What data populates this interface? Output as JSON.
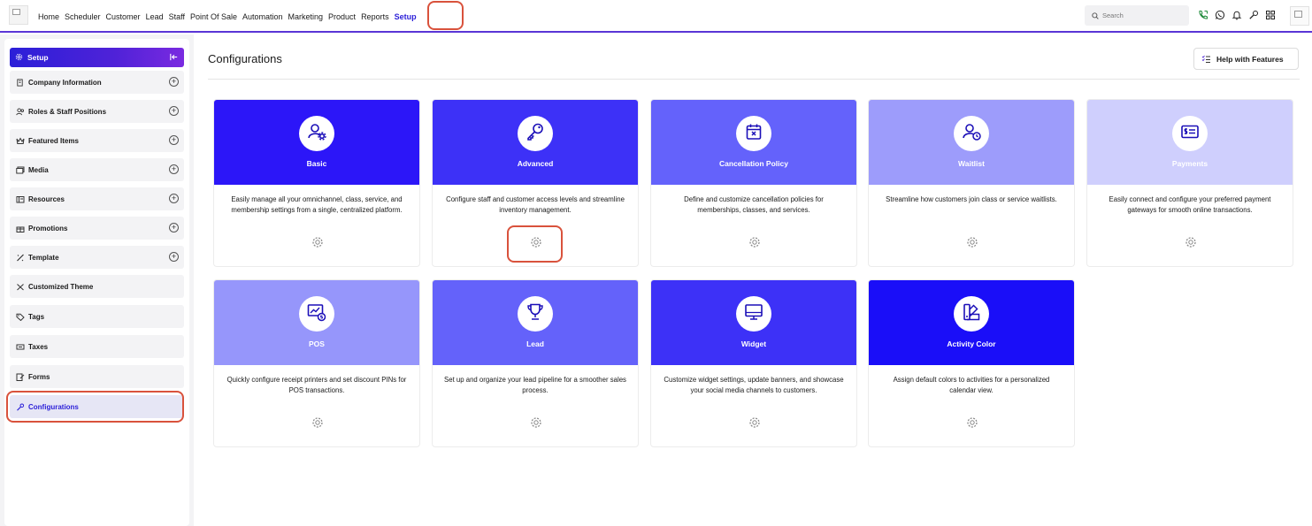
{
  "nav": {
    "items": [
      {
        "label": "Home"
      },
      {
        "label": "Scheduler"
      },
      {
        "label": "Customer"
      },
      {
        "label": "Lead"
      },
      {
        "label": "Staff"
      },
      {
        "label": "Point Of Sale"
      },
      {
        "label": "Automation"
      },
      {
        "label": "Marketing"
      },
      {
        "label": "Product"
      },
      {
        "label": "Reports"
      },
      {
        "label": "Setup",
        "active": true
      }
    ],
    "search_placeholder": "Search",
    "icons": [
      "phone-icon",
      "whatsapp-icon",
      "bell-icon",
      "wrench-icon",
      "apps-grid-icon"
    ]
  },
  "sidebar": {
    "header": "Setup",
    "items": [
      {
        "label": "Company Information",
        "icon": "building-icon",
        "expandable": true
      },
      {
        "label": "Roles & Staff Positions",
        "icon": "users-icon",
        "expandable": true
      },
      {
        "label": "Featured Items",
        "icon": "crown-icon",
        "expandable": true
      },
      {
        "label": "Media",
        "icon": "media-icon",
        "expandable": true
      },
      {
        "label": "Resources",
        "icon": "resources-icon",
        "expandable": true
      },
      {
        "label": "Promotions",
        "icon": "gift-icon",
        "expandable": true
      },
      {
        "label": "Template",
        "icon": "template-icon",
        "expandable": true
      },
      {
        "label": "Customized Theme",
        "icon": "theme-icon",
        "expandable": false
      },
      {
        "label": "Tags",
        "icon": "tag-icon",
        "expandable": false
      },
      {
        "label": "Taxes",
        "icon": "taxes-icon",
        "expandable": false
      },
      {
        "label": "Forms",
        "icon": "forms-icon",
        "expandable": false
      },
      {
        "label": "Configurations",
        "icon": "wrench-icon",
        "expandable": false,
        "active": true
      }
    ]
  },
  "main": {
    "title": "Configurations",
    "help_button": "Help with Features",
    "cards": [
      {
        "title": "Basic",
        "desc": "Easily manage all your omnichannel, class, service, and membership settings from a single, centralized platform.",
        "color": "#2c16f8",
        "icon": "user-settings-icon"
      },
      {
        "title": "Advanced",
        "desc": "Configure staff and customer access levels and streamline inventory management.",
        "color": "#3d31f7",
        "icon": "key-icon"
      },
      {
        "title": "Cancellation Policy",
        "desc": "Define and customize cancellation policies for memberships, classes, and services.",
        "color": "#6462fb",
        "icon": "calendar-x-icon"
      },
      {
        "title": "Waitlist",
        "desc": "Streamline how customers join class or service waitlists.",
        "color": "#9d9cfb",
        "icon": "user-clock-icon"
      },
      {
        "title": "Payments",
        "desc": "Easily connect and configure your preferred payment gateways for smooth online transactions.",
        "color": "#cfcffd",
        "icon": "card-dollar-icon"
      },
      {
        "title": "POS",
        "desc": "Quickly configure receipt printers and set discount PINs for POS transactions.",
        "color": "#9696fb",
        "icon": "pos-chart-icon"
      },
      {
        "title": "Lead",
        "desc": "Set up and organize your lead pipeline for a smoother sales process.",
        "color": "#6462fa",
        "icon": "trophy-icon"
      },
      {
        "title": "Widget",
        "desc": "Customize widget settings, update banners, and showcase your social media channels to customers.",
        "color": "#3d31f7",
        "icon": "monitor-icon"
      },
      {
        "title": "Activity Color",
        "desc": "Assign default colors to activities for a personalized calendar view.",
        "color": "#1a0ef8",
        "icon": "palette-icon"
      }
    ]
  }
}
